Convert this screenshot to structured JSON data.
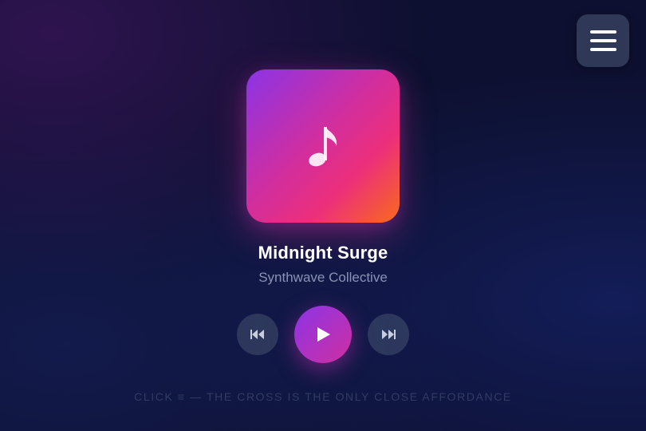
{
  "menu": {
    "icon": "hamburger-menu-icon"
  },
  "track": {
    "title": "Midnight Surge",
    "artist": "Synthwave Collective",
    "artwork_icon": "music-note-icon"
  },
  "controls": {
    "previous_icon": "skip-previous-icon",
    "play_icon": "play-icon",
    "next_icon": "skip-next-icon"
  },
  "hint": "CLICK ≡ — THE CROSS IS THE ONLY CLOSE AFFORDANCE",
  "colors": {
    "background": "#0d1030",
    "accent_purple": "#8b34e8",
    "accent_pink": "#e92f80",
    "accent_orange": "#f86a1c",
    "artist_text": "#8893b4",
    "hint_text": "#2f3c62"
  }
}
